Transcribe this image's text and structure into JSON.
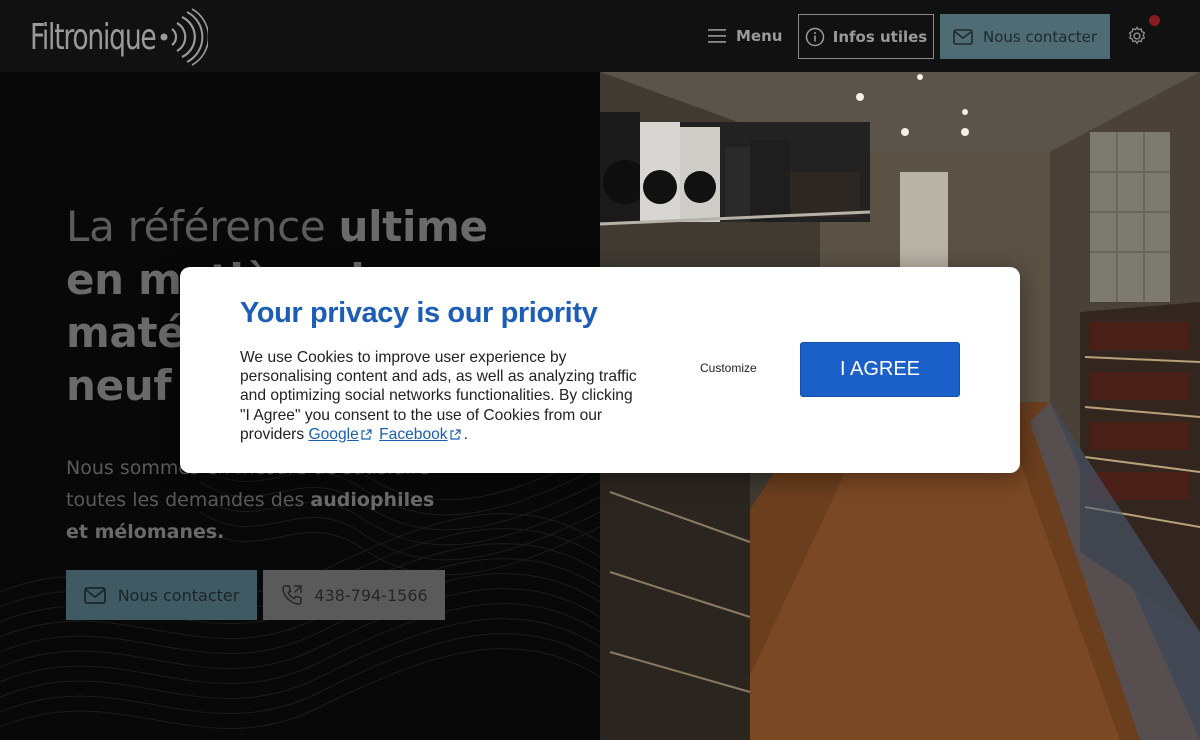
{
  "header": {
    "logo_text": "Filtronique",
    "menu_label": "Menu",
    "info_label": "Infos utiles",
    "contact_label": "Nous contacter"
  },
  "hero": {
    "headline_light_1": "La référence ",
    "headline_bold_1": "ultime",
    "headline_bold_2": "en matière de",
    "headline_bold_3": "matériel",
    "headline_bold_4": "neuf",
    "sub_light_1": "Nous sommes en mesure de satisfaire toutes les demandes des ",
    "sub_bold_1": "audiophiles",
    "sub_bold_2": "et mélomanes.",
    "contact_label": "Nous contacter",
    "phone_label": "438-794-1566"
  },
  "cookie_modal": {
    "title": "Your privacy is our priority",
    "body_text": "We use Cookies to improve user experience by personalising content and ads, as well as analyzing traffic and optimizing social networks functionalities. By clicking \"I Agree\" you consent to the use of Cookies from our providers",
    "link_google": "Google",
    "link_facebook": "Facebook",
    "period": ".",
    "customize_label": "Customize",
    "agree_label": "I AGREE"
  },
  "colors": {
    "accent": "#1b60c8",
    "title_blue": "#1c5db8",
    "header_bg": "#111111",
    "contact_teal": "#4f6b74"
  },
  "icons": [
    "hamburger-icon",
    "info-icon",
    "mail-icon",
    "gear-icon",
    "phone-icon",
    "external-link-icon",
    "logo-waves-icon"
  ]
}
